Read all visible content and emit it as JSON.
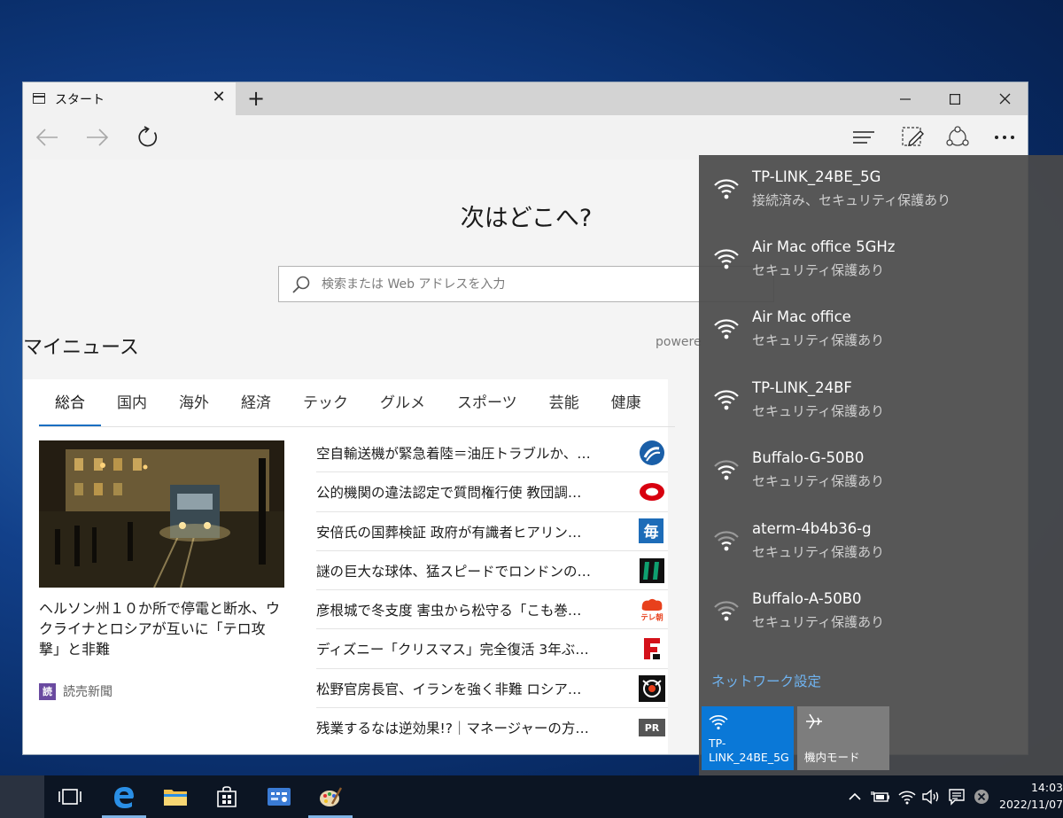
{
  "browser": {
    "tab_title": "スタート",
    "tab_close": "✕",
    "new_tab": "+"
  },
  "content": {
    "hero_title": "次はどこへ?",
    "search_placeholder": "検索または Web アドレスを入力",
    "news_heading": "マイニュース",
    "powered_by": "powere",
    "categories": [
      "総合",
      "国内",
      "海外",
      "経済",
      "テック",
      "グルメ",
      "スポーツ",
      "芸能",
      "健康"
    ],
    "featured": {
      "title": "ヘルソン州１０か所で停電と断水、ウクライナとロシアが互いに「テロ攻撃」と非難",
      "source_logo": "読",
      "source": "読売新聞"
    },
    "headlines": [
      {
        "text": "空自輸送機が緊急着陸＝油圧トラブルか、…",
        "logo": "jiji",
        "color": "#1a5fa8"
      },
      {
        "text": "公的機関の違法認定で質問権行使 教団調…",
        "logo": "tbs",
        "color": "#d8000f"
      },
      {
        "text": "安倍氏の国葬検証 政府が有識者ヒアリン…",
        "logo": "毎",
        "color": "#1d6cb8"
      },
      {
        "text": "謎の巨大な球体、猛スピードでロンドンの…",
        "logo": "huff",
        "color": "#0e6b4b"
      },
      {
        "text": "彦根城で冬支度 害虫から松守る「こも巻…",
        "logo": "テレ朝",
        "color": "#e8401c"
      },
      {
        "text": "ディズニー「クリスマス」完全復活 3年ぶ…",
        "logo": "F",
        "color": "#d4111a"
      },
      {
        "text": "松野官房長官、イランを強く非難 ロシア…",
        "logo": "ann",
        "color": "#111111"
      },
      {
        "text": "残業するなは逆効果!?｜マネージャーの方…",
        "logo": "PR",
        "color": "#555555"
      }
    ]
  },
  "networks": [
    {
      "name": "TP-LINK_24BE_5G",
      "status": "接続済み、セキュリティ保護あり"
    },
    {
      "name": "Air Mac office 5GHz",
      "status": "セキュリティ保護あり"
    },
    {
      "name": "Air Mac office",
      "status": "セキュリティ保護あり"
    },
    {
      "name": "TP-LINK_24BF",
      "status": "セキュリティ保護あり"
    },
    {
      "name": "Buffalo-G-50B0",
      "status": "セキュリティ保護あり"
    },
    {
      "name": "aterm-4b4b36-g",
      "status": "セキュリティ保護あり"
    },
    {
      "name": "Buffalo-A-50B0",
      "status": "セキュリティ保護あり"
    }
  ],
  "flyout": {
    "settings_link": "ネットワーク設定",
    "qa_wifi_label": "TP-LINK_24BE_5G",
    "qa_plane_label": "機内モード"
  },
  "taskbar": {
    "time": "14:03",
    "date": "2022/11/07"
  },
  "colors": {
    "accent": "#0a78d7",
    "link": "#6fb3f0",
    "category_underline": "#1b6fc2"
  }
}
